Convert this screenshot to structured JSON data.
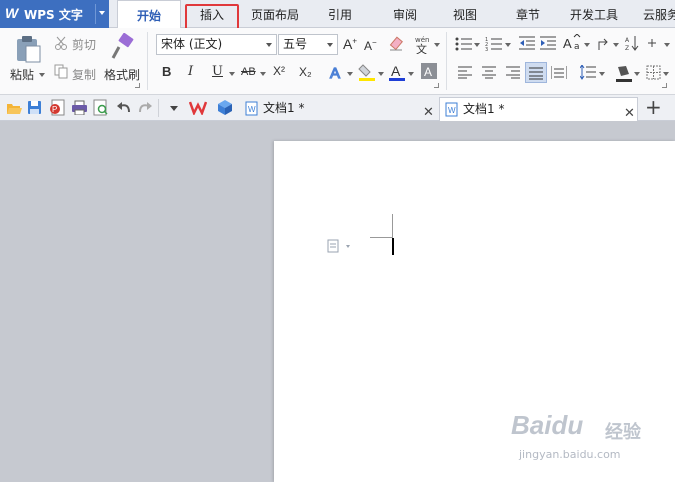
{
  "app": {
    "logo": "W",
    "title": "WPS 文字"
  },
  "menu_tabs": [
    {
      "label": "开始",
      "active": true
    },
    {
      "label": "插入",
      "highlighted": true
    },
    {
      "label": "页面布局"
    },
    {
      "label": "引用"
    },
    {
      "label": "审阅"
    },
    {
      "label": "视图"
    },
    {
      "label": "章节"
    },
    {
      "label": "开发工具"
    },
    {
      "label": "云服务"
    }
  ],
  "ribbon": {
    "clipboard": {
      "paste": "粘贴",
      "cut": "剪切",
      "copy": "复制",
      "format_painter": "格式刷"
    },
    "font": {
      "name": "宋体 (正文)",
      "size": "五号",
      "bold": "B",
      "italic": "I",
      "underline": "U",
      "strikethrough": "AB",
      "superscript": "X²",
      "subscript": "X₂"
    },
    "colors": {
      "highlight": "#ffe600",
      "font_color": "#1f3fd6",
      "accent": "#3d6fc0",
      "selection_outline": "#e0383b"
    }
  },
  "quick_access": {
    "icons": [
      "open-folder-icon",
      "save-icon",
      "export-pdf-icon",
      "print-icon",
      "print-preview-icon",
      "undo-icon",
      "redo-icon",
      "customize-icon",
      "wps-icon",
      "cube-icon"
    ]
  },
  "doc_tabs": [
    {
      "label": "文档1 *",
      "active": false
    },
    {
      "label": "文档1 *",
      "active": true
    }
  ],
  "add_tab": "+",
  "watermark": {
    "brand": "Baidu",
    "cn": "经验",
    "url": "jingyan.baidu.com"
  }
}
